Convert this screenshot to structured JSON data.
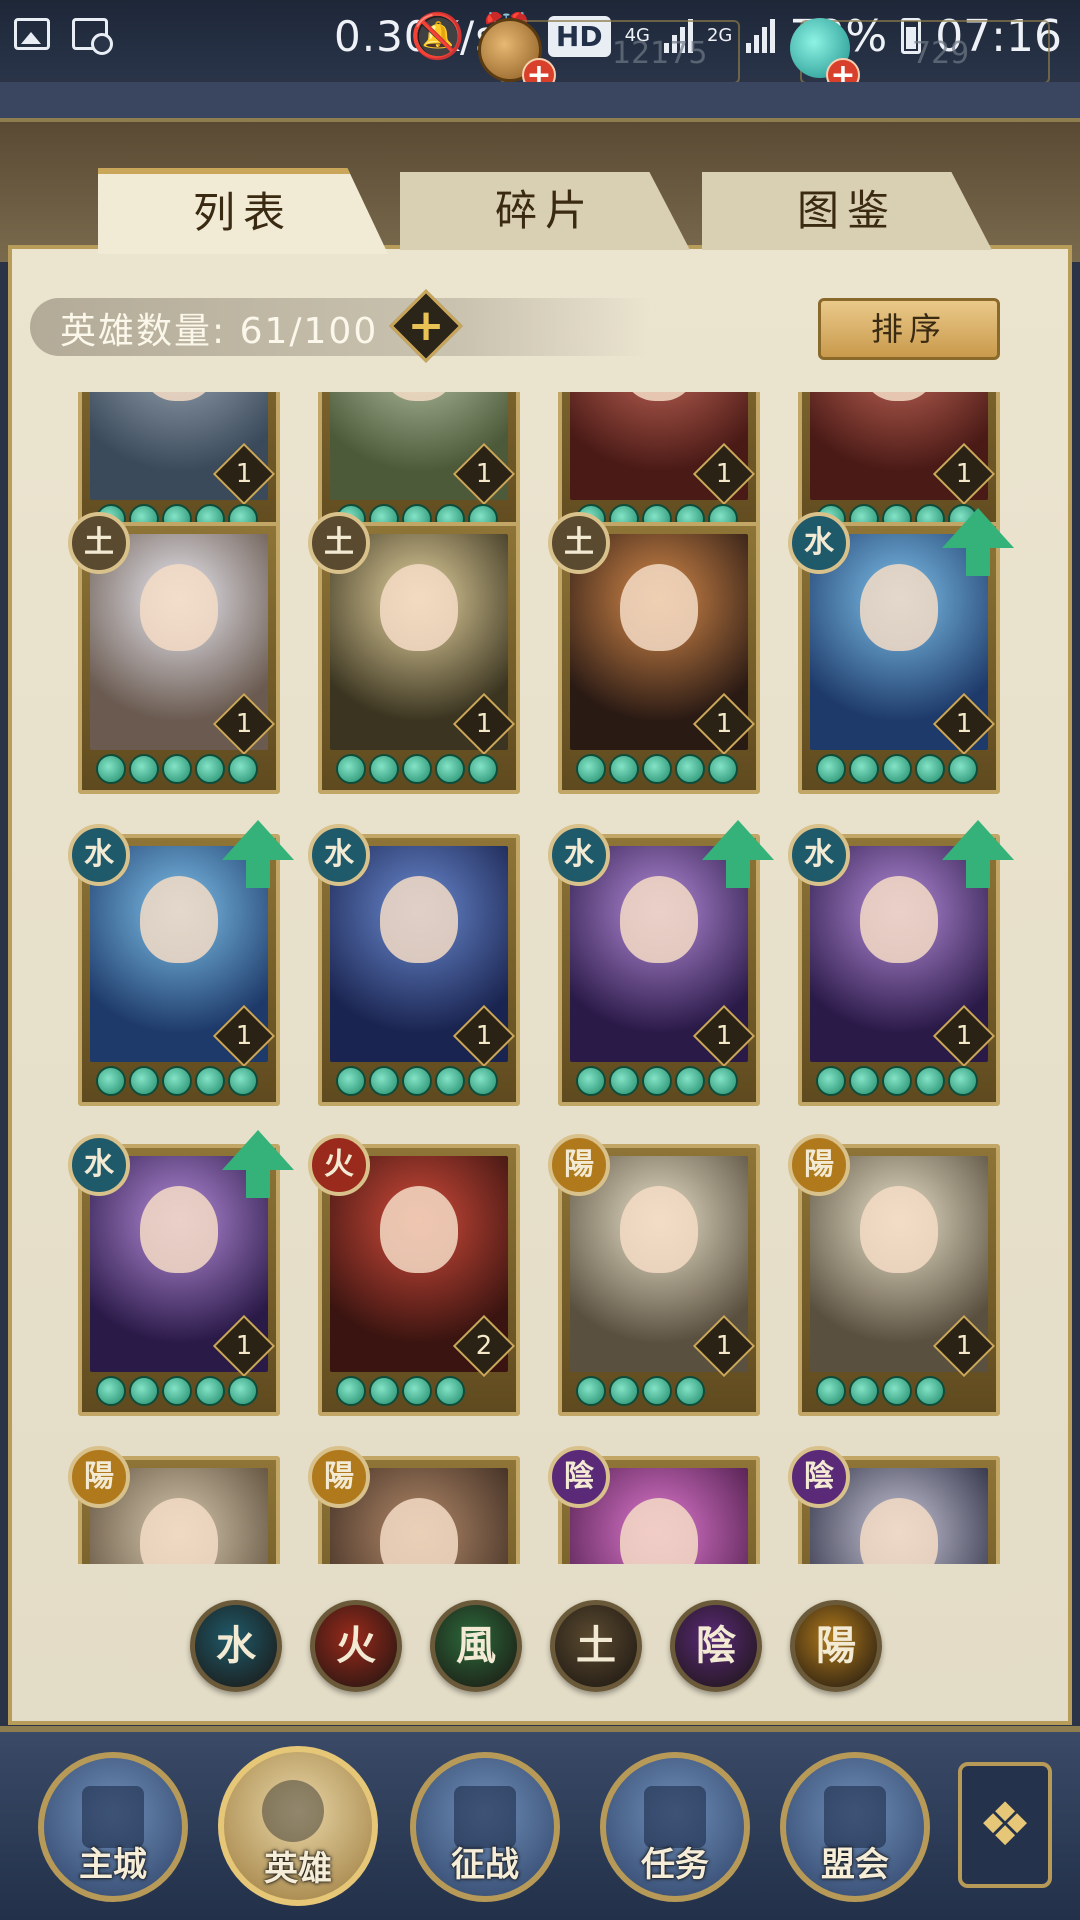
{
  "status_bar": {
    "speed": "0.30K/s",
    "hd": "HD",
    "net_top": "4G",
    "net_bottom": "2G",
    "battery": "72%",
    "time": "07:16"
  },
  "currency": {
    "coins": "12175",
    "gems": "729"
  },
  "tabs": {
    "list": "列表",
    "fragments": "碎片",
    "collection": "图鉴",
    "active": "list"
  },
  "hero_count": {
    "text": "英雄数量: 61/100",
    "plus": "+"
  },
  "sort_button": "排序",
  "colors": {
    "water": "#1f5a6a",
    "fire": "#9a2a1c",
    "wind": "#2c6a3c",
    "earth": "#5a4a30",
    "yin": "#5a2a78",
    "yang": "#b07a1c",
    "upgrade": "#35b27a"
  },
  "heroes": [
    {
      "element": "",
      "level": "1",
      "stars": 5,
      "upgrade": false
    },
    {
      "element": "",
      "level": "1",
      "stars": 5,
      "upgrade": false
    },
    {
      "element": "",
      "level": "1",
      "stars": 5,
      "upgrade": false
    },
    {
      "element": "",
      "level": "1",
      "stars": 5,
      "upgrade": false
    },
    {
      "element": "土",
      "level": "1",
      "stars": 5,
      "upgrade": false
    },
    {
      "element": "土",
      "level": "1",
      "stars": 5,
      "upgrade": false
    },
    {
      "element": "土",
      "level": "1",
      "stars": 5,
      "upgrade": false
    },
    {
      "element": "水",
      "level": "1",
      "stars": 5,
      "upgrade": true
    },
    {
      "element": "水",
      "level": "1",
      "stars": 5,
      "upgrade": true
    },
    {
      "element": "水",
      "level": "1",
      "stars": 5,
      "upgrade": false
    },
    {
      "element": "水",
      "level": "1",
      "stars": 5,
      "upgrade": true
    },
    {
      "element": "水",
      "level": "1",
      "stars": 5,
      "upgrade": true
    },
    {
      "element": "水",
      "level": "1",
      "stars": 5,
      "upgrade": true
    },
    {
      "element": "火",
      "level": "2",
      "stars": 4,
      "upgrade": false
    },
    {
      "element": "陽",
      "level": "1",
      "stars": 4,
      "upgrade": false
    },
    {
      "element": "陽",
      "level": "1",
      "stars": 4,
      "upgrade": false
    },
    {
      "element": "陽",
      "level": "",
      "stars": 0,
      "upgrade": false
    },
    {
      "element": "陽",
      "level": "",
      "stars": 0,
      "upgrade": false
    },
    {
      "element": "陰",
      "level": "",
      "stars": 0,
      "upgrade": false
    },
    {
      "element": "陰",
      "level": "",
      "stars": 0,
      "upgrade": false
    }
  ],
  "filters": [
    {
      "key": "water",
      "glyph": "水"
    },
    {
      "key": "fire",
      "glyph": "火"
    },
    {
      "key": "wind",
      "glyph": "風"
    },
    {
      "key": "earth",
      "glyph": "土"
    },
    {
      "key": "yin",
      "glyph": "陰"
    },
    {
      "key": "yang",
      "glyph": "陽"
    }
  ],
  "nav": {
    "city": "主城",
    "heroes": "英雄",
    "battle": "征战",
    "tasks": "任务",
    "alliance": "盟会",
    "menu_icon": "❖"
  }
}
